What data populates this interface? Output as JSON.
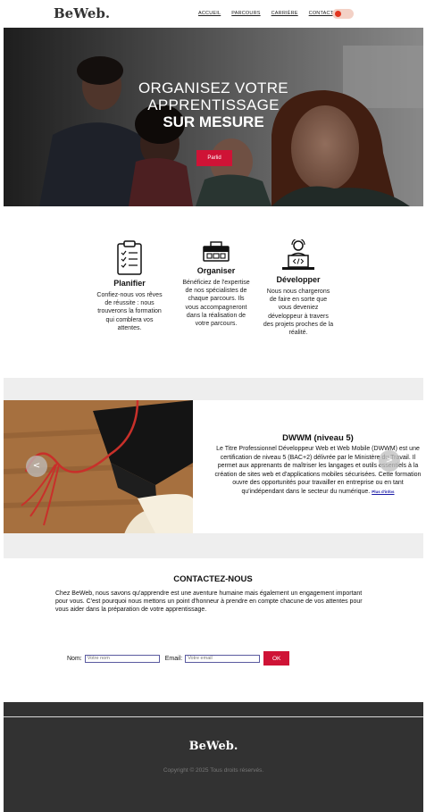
{
  "brand": {
    "logo": "BeWeb."
  },
  "nav": {
    "links": [
      "ACCUEIL",
      "PARCOURS",
      "CARRIÈRE",
      "CONTACT"
    ]
  },
  "hero": {
    "line1": "ORGANISEZ VOTRE",
    "line2": "APPRENTISSAGE",
    "line3": "SUR MESURE",
    "button": "Parlid"
  },
  "features": [
    {
      "icon": "clipboard-checklist-icon",
      "title": "Planifier",
      "text": "Confiez-nous vos rêves de réussite : nous trouverons la formation qui comblera vos attentes."
    },
    {
      "icon": "toolbox-icon",
      "title": "Organiser",
      "text": "Bénéficiez de l'expertise de nos spécialistes de chaque parcours. Ils vous accompagneront dans la réalisation de votre parcours."
    },
    {
      "icon": "developer-laptop-icon",
      "title": "Développer",
      "text": "Nous nous chargerons de faire en sorte que vous deveniez développeur à travers des projets proches de la réalité."
    }
  ],
  "dwwm": {
    "title": "DWWM (niveau 5)",
    "text": "Le Titre Professionnel Développeur Web et Web Mobile (DWWM) est une certification de niveau 5 (BAC+2) délivrée par le Ministère du Travail. Il permet aux apprenants de maîtriser les langages et outils essentiels à la création de sites web et d'applications mobiles sécurisées. Cette formation ouvre des opportunités pour travailler en entreprise ou en tant qu'indépendant dans le secteur du numérique.",
    "link": "Plus d'infos",
    "prev_arrow": "<",
    "next_arrow": ">"
  },
  "contact": {
    "title": "CONTACTEZ-NOUS",
    "text": "Chez BeWeb, nous savons qu'apprendre est une aventure humaine mais également un engagement important pour vous. C'est pourquoi nous mettons un point d'honneur à prendre en compte chacune de vos attentes pour vous aider dans la préparation de votre apprentissage.",
    "name_label": "Nom:",
    "name_placeholder": "Votre nom",
    "email_label": "Email:",
    "email_placeholder": "Votre email",
    "submit": "OK"
  },
  "footer": {
    "logo": "BeWeb.",
    "copyright": "Copyright © 2025 Tous droits réservés."
  },
  "colors": {
    "accent": "#cf1336",
    "toggle_knob": "#e2351f",
    "footer_bg": "#323232",
    "band_bg": "#eeeeee"
  }
}
